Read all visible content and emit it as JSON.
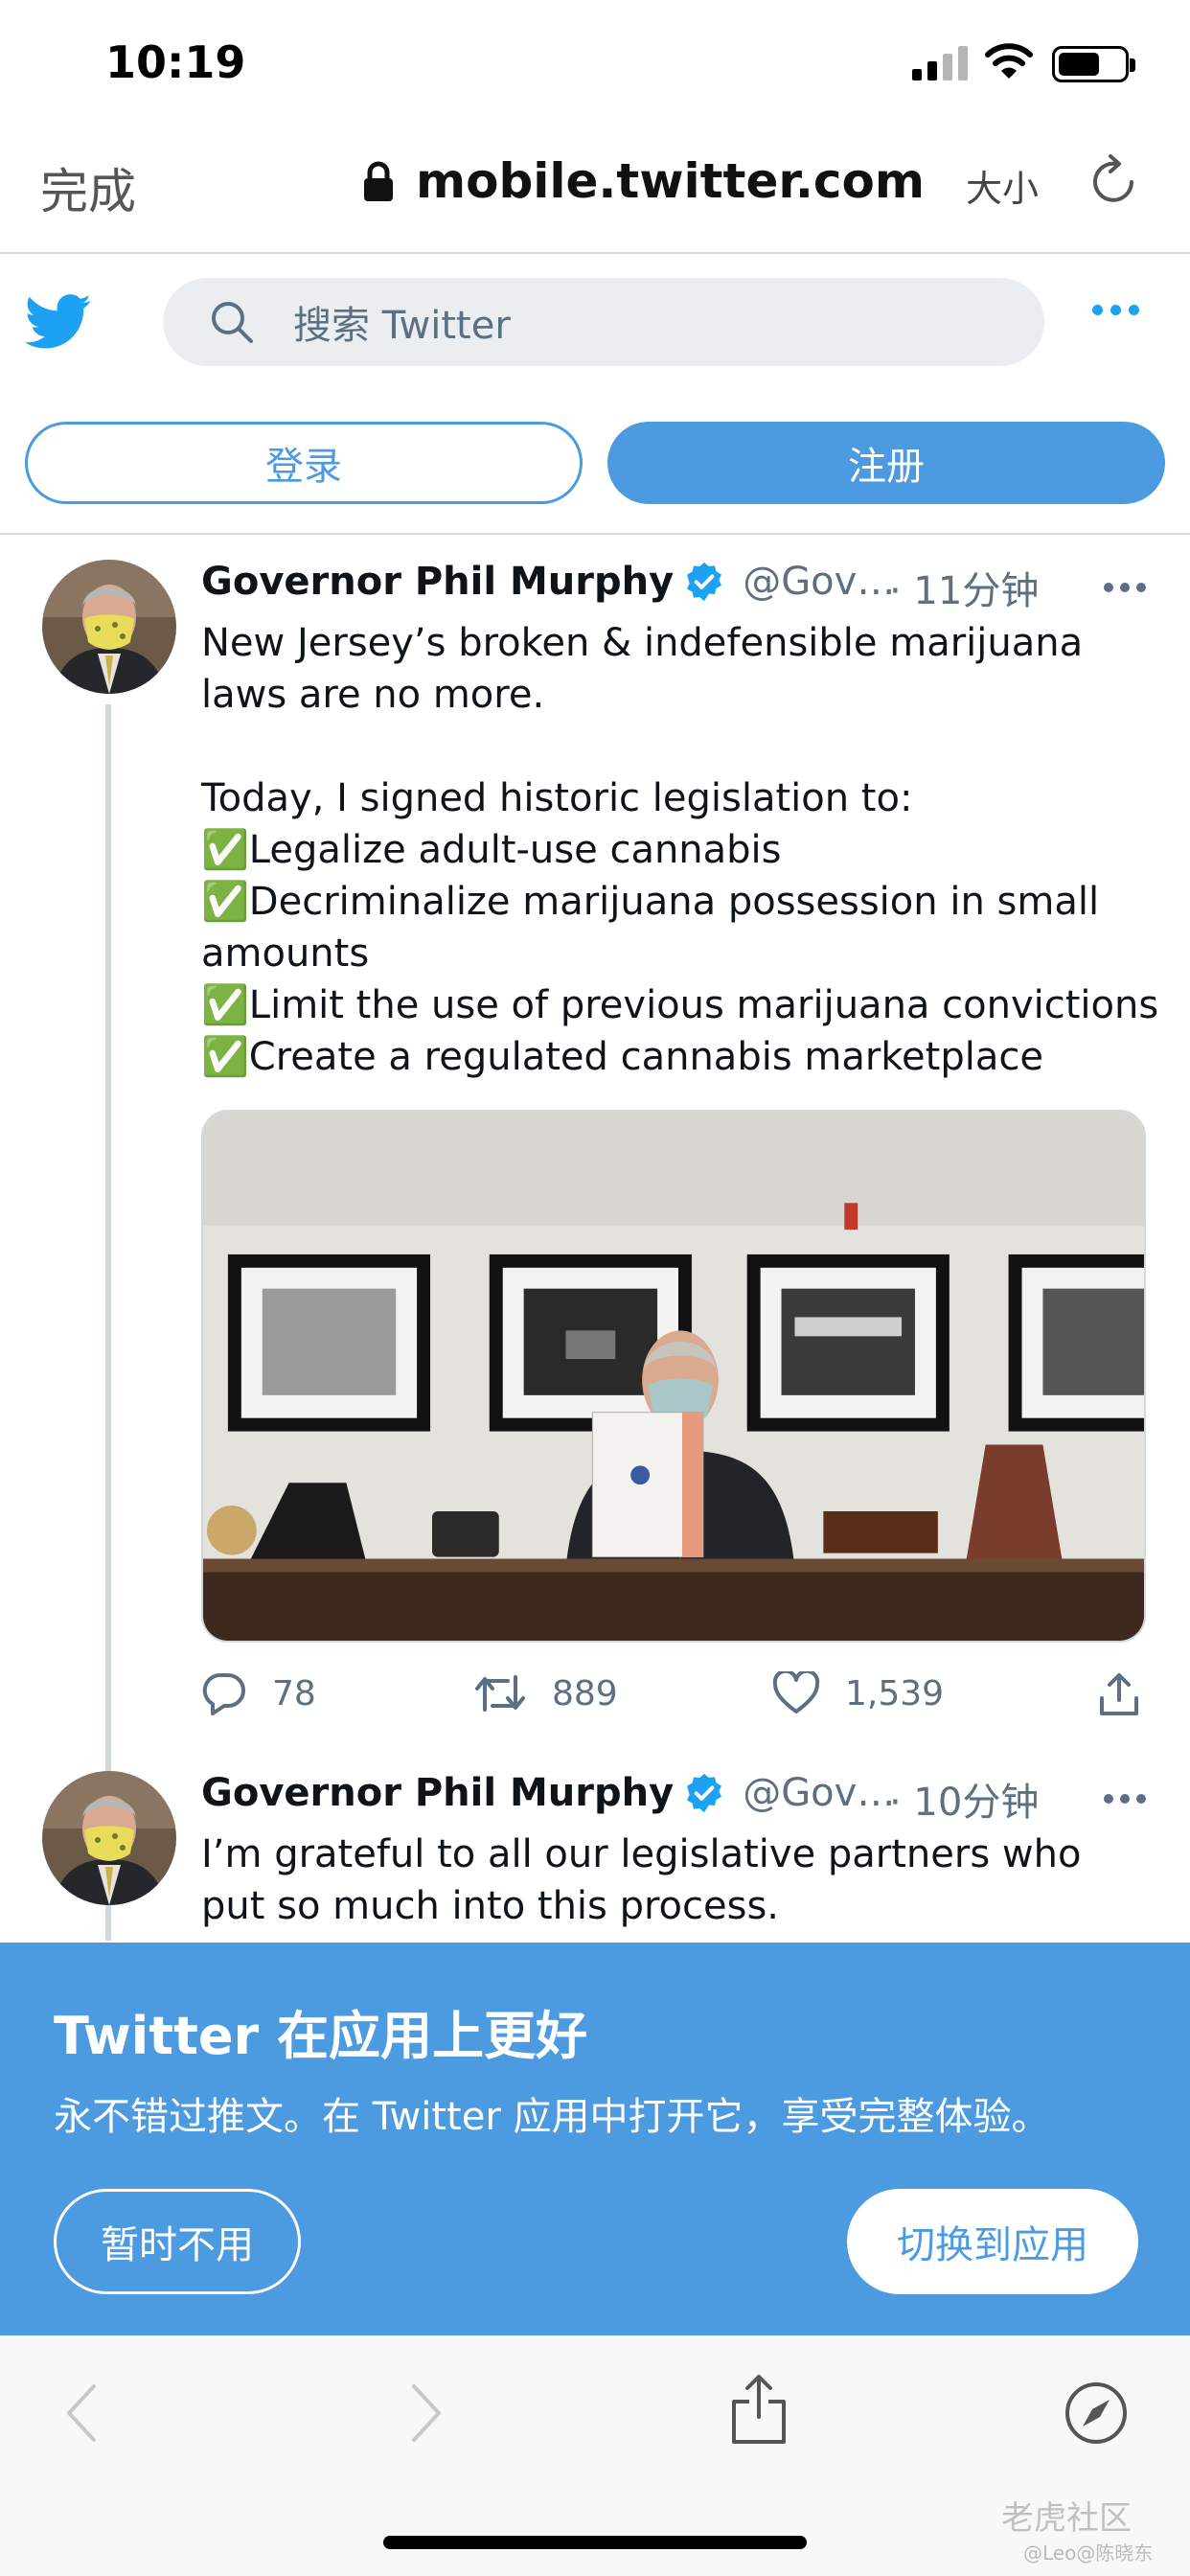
{
  "status_bar": {
    "time": "10:19"
  },
  "browser": {
    "done_label": "完成",
    "url": "mobile.twitter.com",
    "text_size_label": "大小"
  },
  "header": {
    "search_placeholder": "搜索 Twitter"
  },
  "auth": {
    "login_label": "登录",
    "signup_label": "注册"
  },
  "tweets": [
    {
      "name": "Governor Phil Murphy",
      "handle": "@Gov…",
      "time": "· 11分钟",
      "text": "New Jersey’s broken & indefensible marijuana laws are no more.\n\nToday, I signed historic legislation to:\n✅Legalize adult-use cannabis\n✅Decriminalize marijuana possession in small amounts\n✅Limit the use of previous marijuana convictions\n✅Create a regulated cannabis marketplace",
      "replies": "78",
      "retweets": "889",
      "likes": "1,539"
    },
    {
      "name": "Governor Phil Murphy",
      "handle": "@Gov…",
      "time": "· 10分钟",
      "text": "I’m grateful to all our legislative partners who put so much into this process."
    }
  ],
  "banner": {
    "title": "Twitter 在应用上更好",
    "subtitle": "永不错过推文。在 Twitter 应用中打开它，享受完整体验。",
    "not_now_label": "暂时不用",
    "switch_label": "切换到应用"
  },
  "watermark": {
    "text": "老虎社区",
    "sub": "@Leo@陈晓东"
  },
  "colors": {
    "accent": "#4c9ae0",
    "twitter_blue": "#1da1f2",
    "banner": "#4c9ae0"
  }
}
